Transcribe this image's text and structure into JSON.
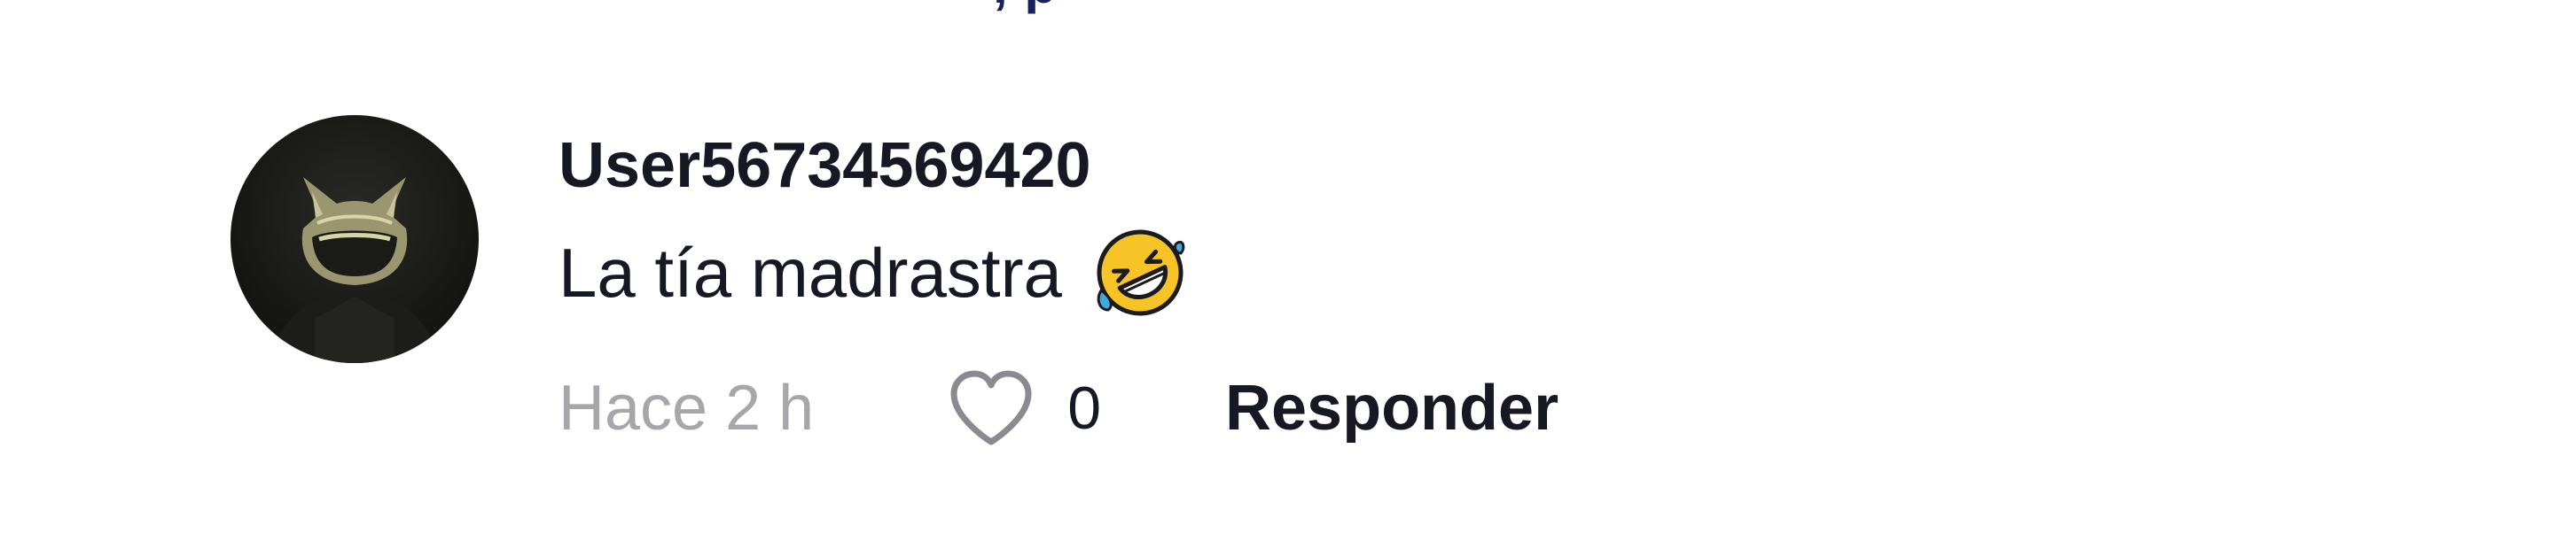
{
  "previous_comment": {
    "clipped_fragment": ", p"
  },
  "comment": {
    "username": "User56734569420",
    "text": "La tía madrastra",
    "emoji_icon": "rolling-on-floor-laughing-emoji",
    "time": "Hace 2 h",
    "like_icon": "heart-outline-icon",
    "like_count": "0",
    "reply_label": "Responder"
  },
  "colors": {
    "text": "#161823",
    "muted": "#a7a7ab",
    "link_fragment": "#1b1f5a"
  }
}
